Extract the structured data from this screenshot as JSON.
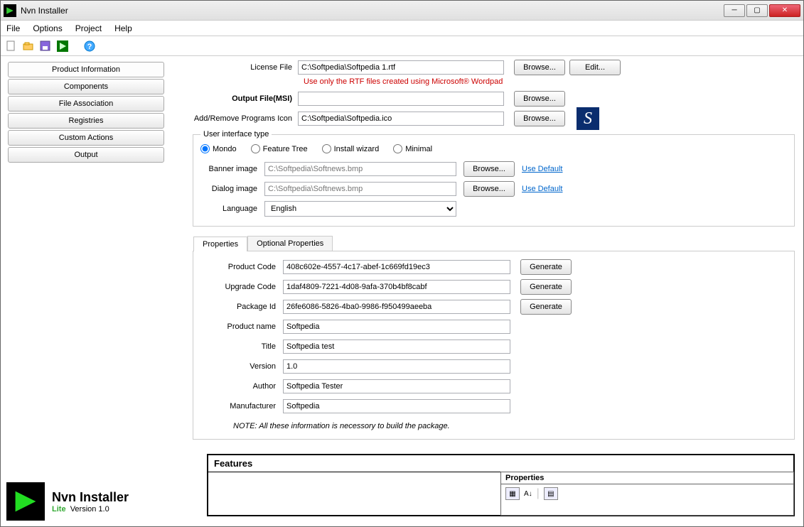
{
  "window": {
    "title": "Nvn Installer"
  },
  "menu": {
    "items": [
      "File",
      "Options",
      "Project",
      "Help"
    ]
  },
  "nav": {
    "items": [
      "Product Information",
      "Components",
      "File Association",
      "Registries",
      "Custom Actions",
      "Output"
    ],
    "selected_index": 0
  },
  "fields": {
    "license_label": "License File",
    "license_value": "C:\\Softpedia\\Softpedia 1.rtf",
    "license_hint": "Use only the RTF files created using Microsoft® Wordpad",
    "output_label": "Output File(MSI)",
    "output_value": "",
    "icon_label": "Add/Remove Programs Icon",
    "icon_value": "C:\\Softpedia\\Softpedia.ico",
    "browse": "Browse...",
    "edit": "Edit..."
  },
  "uitype": {
    "legend": "User interface type",
    "options": [
      "Mondo",
      "Feature Tree",
      "Install wizard",
      "Minimal"
    ],
    "selected": "Mondo",
    "banner_label": "Banner image",
    "banner_value": "C:\\Softpedia\\Softnews.bmp",
    "dialog_label": "Dialog image",
    "dialog_value": "C:\\Softpedia\\Softnews.bmp",
    "use_default": "Use Default",
    "language_label": "Language",
    "language_value": "English"
  },
  "tabs": {
    "items": [
      "Properties",
      "Optional Properties"
    ],
    "active": 0
  },
  "props": {
    "product_code_label": "Product Code",
    "product_code": "408c602e-4557-4c17-abef-1c669fd19ec3",
    "upgrade_code_label": "Upgrade Code",
    "upgrade_code": "1daf4809-7221-4d08-9afa-370b4bf8cabf",
    "package_id_label": "Package Id",
    "package_id": "26fe6086-5826-4ba0-9986-f950499aeeba",
    "product_name_label": "Product name",
    "product_name": "Softpedia",
    "title_label": "Title",
    "title": "Softpedia test",
    "version_label": "Version",
    "version": "1.0",
    "author_label": "Author",
    "author": "Softpedia Tester",
    "manufacturer_label": "Manufacturer",
    "manufacturer": "Softpedia",
    "generate": "Generate",
    "note": "NOTE: All these information is necessory to build the package."
  },
  "features": {
    "title": "Features",
    "props_title": "Properties"
  },
  "brand": {
    "name": "Nvn Installer",
    "edition": "Lite",
    "version": "Version 1.0"
  }
}
